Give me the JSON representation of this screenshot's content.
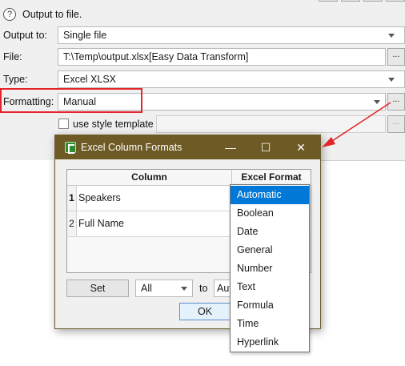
{
  "background": {
    "output_to_file_label": "Output to file.",
    "help_glyph": "?",
    "output_to": {
      "label": "Output to:",
      "value": "Single file"
    },
    "file": {
      "label": "File:",
      "value": "T:\\Temp\\output.xlsx[Easy Data Transform]",
      "browse_label": "..."
    },
    "type": {
      "label": "Type:",
      "value": "Excel XLSX"
    },
    "formatting": {
      "label": "Formatting:",
      "value": "Manual",
      "edit_label": "..."
    },
    "style_template": {
      "label": "use style template",
      "checked": false,
      "browse_label": "..."
    }
  },
  "dialog": {
    "title": "Excel Column Formats",
    "minimize_glyph": "—",
    "maximize_glyph": "☐",
    "close_glyph": "✕",
    "table": {
      "headers": [
        "Column",
        "Excel Format"
      ],
      "rows": [
        {
          "num": "1",
          "column": "Speakers"
        },
        {
          "num": "2",
          "column": "Full Name"
        }
      ]
    },
    "set_button": "Set",
    "from_select": "All",
    "to_label": "to",
    "to_select": "Aut",
    "ok_button": "OK"
  },
  "dropdown": {
    "options": [
      "Automatic",
      "Boolean",
      "Date",
      "General",
      "Number",
      "Text",
      "Formula",
      "Time",
      "Hyperlink"
    ],
    "selected": "Automatic"
  },
  "colors": {
    "titlebar": "#6e5a24",
    "highlight_box": "#e3262b",
    "annotation_arrow": "#e3262b",
    "selection": "#0078d7"
  },
  "icons": [
    "help-icon",
    "chevron-down-icon",
    "excel-app-icon",
    "minimize-icon",
    "maximize-icon",
    "close-icon",
    "annotation-arrow-icon"
  ]
}
